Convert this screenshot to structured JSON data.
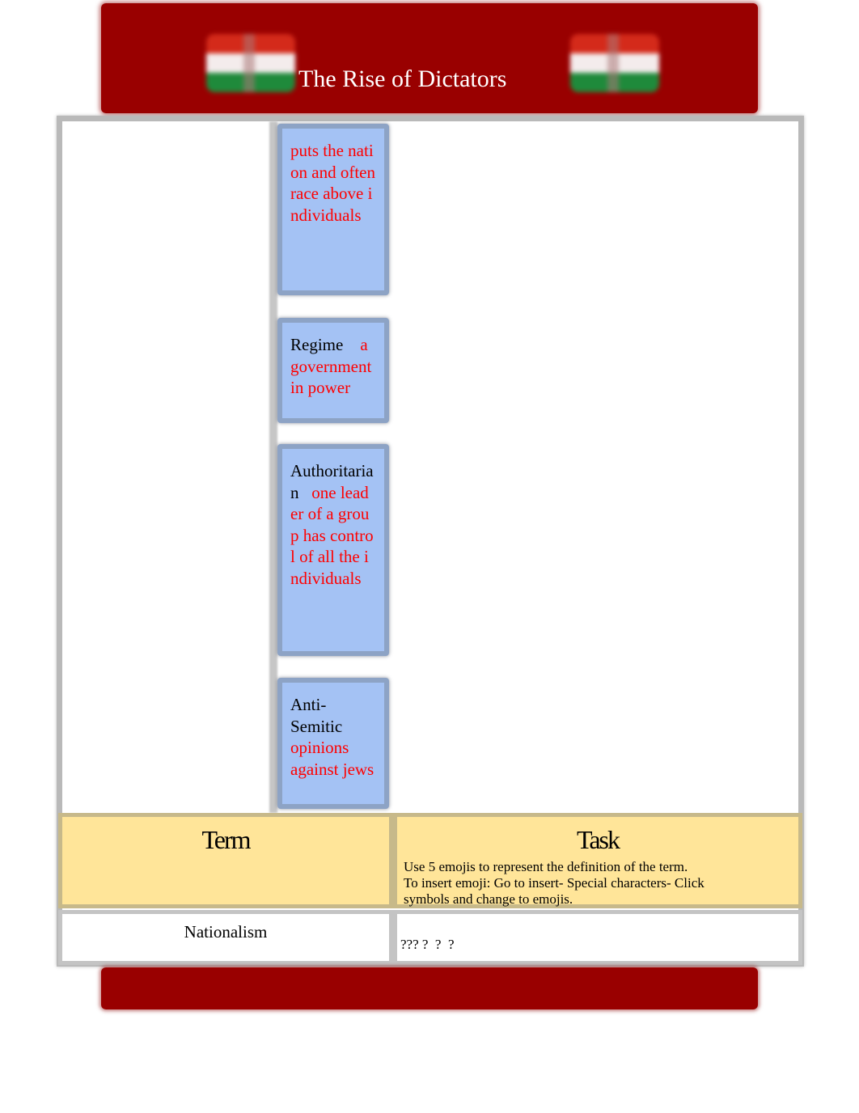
{
  "header": {
    "title": "The Rise of Dictators",
    "flag_colors": [
      "#d42a1a",
      "#f4ecec",
      "#1f8a3b"
    ],
    "banner_color": "#990000"
  },
  "vocab": [
    {
      "term": "",
      "definition": "puts the nation and often race above individuals"
    },
    {
      "term": "Regime",
      "definition": "a government in power"
    },
    {
      "term": "Authoritarian",
      "definition": "one leader of a group has control of all the individuals"
    },
    {
      "term": "Anti-Semitic",
      "definition": "opinions against jews"
    }
  ],
  "table": {
    "headers": {
      "term": "Term",
      "task": "Task"
    },
    "task_instructions": [
      "Use 5 emojis to represent the definition of the term.",
      "To insert emoji: Go to insert- Special characters- Click",
      "symbols and change to emojis."
    ],
    "rows": [
      {
        "term": "Nationalism",
        "task": "??? ?  ?  ?"
      }
    ]
  },
  "colors": {
    "vocab_box": "#a4c2f4",
    "definition_text": "#ff0000",
    "header_row": "#ffe599"
  }
}
